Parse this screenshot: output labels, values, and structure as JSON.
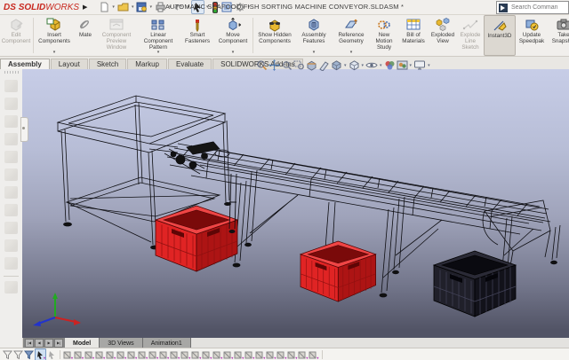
{
  "titlebar": {
    "logo_ds": "DS",
    "logo_solid": "SOLID",
    "logo_works": "WORKS",
    "expander": "▶",
    "title": "AUTOMATIC SEAFOOD FISH SORTING MACHINE CONVEYOR.SLDASM *",
    "search_placeholder": "Search Comman",
    "quick_icons": [
      "new-document-icon",
      "open-folder-icon",
      "save-icon",
      "print-icon",
      "undo-icon",
      "select-cursor-icon",
      "resource-monitor-icon",
      "display-settings-icon",
      "options-gear-icon"
    ]
  },
  "ribbon": {
    "buttons": [
      {
        "label": "Edit Component",
        "state": "disabled"
      },
      {
        "label": "Insert Components",
        "caret": "▾"
      },
      {
        "label": "Mate"
      },
      {
        "label": "Component Preview Window",
        "state": "disabled"
      },
      {
        "label": "Linear Component Pattern",
        "caret": "▾"
      },
      {
        "label": "Smart Fasteners"
      },
      {
        "label": "Move Component",
        "caret": "▾"
      },
      {
        "label": "Show Hidden Components"
      },
      {
        "label": "Assembly Features",
        "caret": "▾"
      },
      {
        "label": "Reference Geometry",
        "caret": "▾"
      },
      {
        "label": "New Motion Study"
      },
      {
        "label": "Bill of Materials"
      },
      {
        "label": "Exploded View"
      },
      {
        "label": "Explode Line Sketch",
        "state": "disabled"
      },
      {
        "label": "Instant3D",
        "state": "active"
      },
      {
        "label": "Update Speedpak"
      },
      {
        "label": "Take Snapshot"
      }
    ]
  },
  "command_tabs": {
    "items": [
      {
        "label": "Assembly",
        "active": true
      },
      {
        "label": "Layout"
      },
      {
        "label": "Sketch"
      },
      {
        "label": "Markup"
      },
      {
        "label": "Evaluate"
      },
      {
        "label": "SOLIDWORKS Add-Ins"
      }
    ]
  },
  "headsup": {
    "icons": [
      "zoom-to-fit-icon",
      "zoom-to-area-icon",
      "previous-view-icon",
      "magnifier-icon",
      "section-view-icon",
      "dynamic-annotation-icon",
      "view-orientation-icon",
      "display-style-icon",
      "hide-show-items-icon",
      "edit-appearance-icon",
      "apply-scene-icon",
      "view-settings-icon"
    ]
  },
  "left_toolbar": {
    "icons": [
      "feature-tool-icon",
      "feature-tool-icon",
      "feature-tool-icon",
      "feature-tool-icon",
      "feature-tool-icon",
      "feature-tool-icon",
      "feature-tool-icon",
      "feature-tool-icon",
      "feature-tool-icon",
      "feature-tool-icon",
      "feature-tool-icon"
    ]
  },
  "viewport": {
    "model_name": "seafood-sorting-conveyor-wireframe",
    "crate_colors": {
      "red": "#d42020",
      "dark": "#1b1b24"
    },
    "triad_colors": {
      "x": "#cc2222",
      "y": "#22aa22",
      "z": "#2233cc"
    }
  },
  "bottom_tabs": {
    "nav_icons": [
      "first-tab-icon",
      "previous-tab-icon",
      "next-tab-icon",
      "last-tab-icon"
    ],
    "items": [
      {
        "label": "Model",
        "active": true
      },
      {
        "label": "3D Views"
      },
      {
        "label": "Animation1"
      }
    ]
  },
  "filter_toolbar": {
    "lead_icons": [
      "filter-funnel-icon",
      "clear-filters-funnel-icon",
      "apply-filters-funnel-icon",
      "select-cursor-icon",
      "select-other-cursor-icon"
    ],
    "generic_icons": [
      "filter-vertices-icon",
      "filter-edges-icon",
      "filter-faces-icon",
      "filter-solid-bodies-icon",
      "filter-axes-icon",
      "filter-planes-icon",
      "filter-origins-icon",
      "filter-coordinate-systems-icon",
      "filter-sketch-points-icon",
      "filter-sketch-segments-icon",
      "filter-midpoints-icon",
      "filter-center-marks-icon",
      "filter-centerlines-icon",
      "filter-dimensions-icon",
      "filter-annotations-icon",
      "filter-notes-icon",
      "filter-balloons-icon",
      "filter-gtols-icon",
      "filter-datums-icon",
      "filter-weld-symbols-icon",
      "filter-surface-finish-icon",
      "filter-blocks-icon",
      "filter-connection-points-icon",
      "filter-routing-points-icon"
    ]
  }
}
